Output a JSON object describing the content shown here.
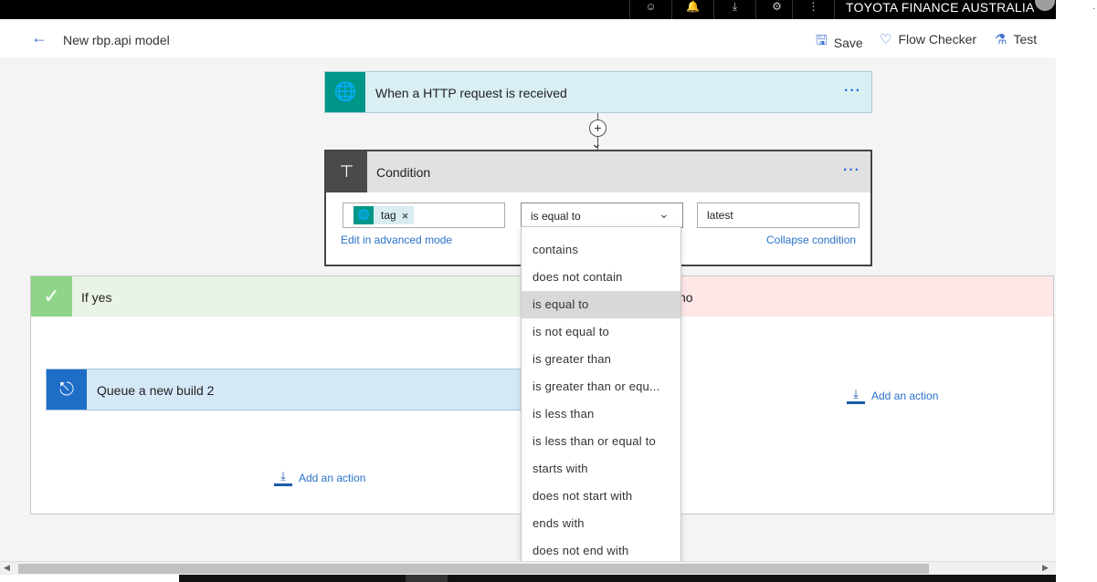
{
  "top_bar": {
    "icons": [
      "smiley-icon",
      "bell-icon",
      "download-icon",
      "gear-icon",
      "more-vertical-icon"
    ],
    "icon_glyphs": [
      "☺",
      "🔔",
      "⤓",
      "⚙",
      "⋮"
    ],
    "org_name": "TOYOTA FINANCE AUSTRALIA"
  },
  "header": {
    "back_glyph": "←",
    "title": "New rbp.api model",
    "save_label": "Save",
    "flow_checker_label": "Flow Checker",
    "test_label": "Test",
    "save_glyph": "🖫",
    "flow_checker_glyph": "♡",
    "test_glyph": "⚗"
  },
  "trigger": {
    "icon": "globe-icon",
    "glyph": "🌐",
    "title": "When a HTTP request is received",
    "more": "···"
  },
  "connector": {
    "plus": "+",
    "arrow": "⌄"
  },
  "condition": {
    "icon": "condition-icon",
    "glyph": "⊤",
    "title": "Condition",
    "more": "···",
    "token_label": "tag",
    "token_glyph": "🌐",
    "token_remove": "×",
    "operator_value": "is equal to",
    "operator_chevron": "⌄",
    "value": "latest",
    "edit_advanced": "Edit in advanced mode",
    "collapse": "Collapse condition"
  },
  "operator_options": [
    "contains",
    "does not contain",
    "is equal to",
    "is not equal to",
    "is greater than",
    "is greater than or equ...",
    "is less than",
    "is less than or equal to",
    "starts with",
    "does not start with",
    "ends with",
    "does not end with"
  ],
  "selected_operator_index": 2,
  "yes_branch": {
    "check_glyph": "✓",
    "label": "If yes",
    "action_title": "Queue a new build 2",
    "action_glyph": "⎋",
    "add_action": "Add an action",
    "add_glyph": "⤓"
  },
  "no_branch": {
    "label": "no",
    "add_action": "Add an action",
    "add_glyph": "⤓"
  },
  "scrollbar": {
    "left": "◀",
    "right": "▶"
  },
  "colors": {
    "trigger_accent": "#009688",
    "yes_accent": "#8ed58a",
    "no_background": "#fde7e7",
    "link": "#2a72c8",
    "action_accent": "#1e6ec8"
  }
}
